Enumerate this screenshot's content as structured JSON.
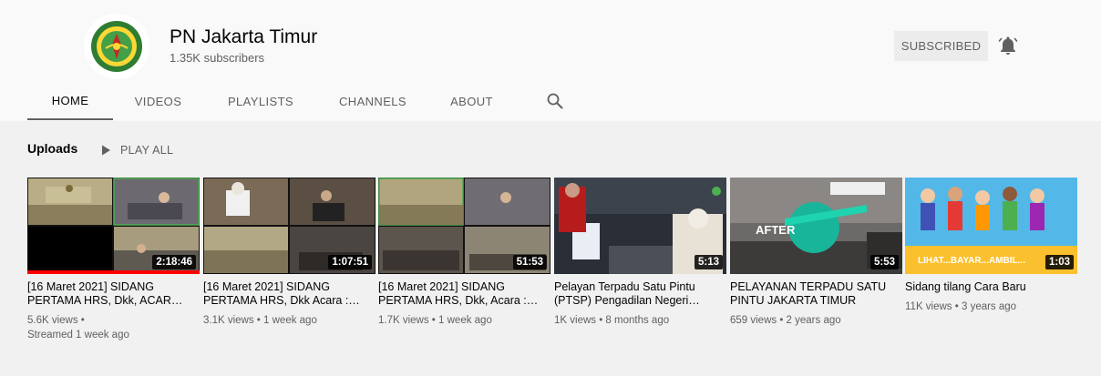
{
  "channel": {
    "name": "PN Jakarta Timur",
    "subscribers": "1.35K subscribers",
    "avatar_icon": "court-emblem-icon",
    "subscribe_label": "SUBSCRIBED",
    "bell_icon": "bell-icon"
  },
  "tabs": [
    {
      "label": "HOME",
      "active": true
    },
    {
      "label": "VIDEOS",
      "active": false
    },
    {
      "label": "PLAYLISTS",
      "active": false
    },
    {
      "label": "CHANNELS",
      "active": false
    },
    {
      "label": "ABOUT",
      "active": false
    }
  ],
  "search_icon": "search-icon",
  "uploads": {
    "title": "Uploads",
    "play_all_label": "PLAY ALL",
    "play_icon": "play-icon",
    "videos": [
      {
        "title": "[16 Maret 2021] SIDANG PERTAMA HRS, Dkk, ACAR…",
        "duration": "2:18:46",
        "meta1": "5.6K views •",
        "meta2": "Streamed 1 week ago",
        "watched_fraction": 1.0,
        "thumb_kind": "courtroom-green"
      },
      {
        "title": "[16 Maret 2021] SIDANG PERTAMA HRS, Dkk Acara :…",
        "duration": "1:07:51",
        "meta1": "3.1K views • 1 week ago",
        "meta2": "",
        "watched_fraction": 0,
        "thumb_kind": "courtroom-grid"
      },
      {
        "title": "[16 Maret 2021] SIDANG PERTAMA HRS, Dkk, Acara :…",
        "duration": "51:53",
        "meta1": "1.7K views • 1 week ago",
        "meta2": "",
        "watched_fraction": 0,
        "thumb_kind": "courtroom-green"
      },
      {
        "title": "Pelayan Terpadu Satu Pintu (PTSP) Pengadilan Negeri…",
        "duration": "5:13",
        "meta1": "1K views • 8 months ago",
        "meta2": "",
        "watched_fraction": 0,
        "thumb_kind": "service-desk"
      },
      {
        "title": "PELAYANAN TERPADU SATU PINTU JAKARTA TIMUR",
        "duration": "5:53",
        "meta1": "659 views • 2 years ago",
        "meta2": "",
        "watched_fraction": 0,
        "thumb_kind": "after-room",
        "thumb_text": "AFTER"
      },
      {
        "title": "Sidang tilang Cara Baru",
        "duration": "1:03",
        "meta1": "11K views • 3 years ago",
        "meta2": "",
        "watched_fraction": 0,
        "thumb_kind": "cartoon-people",
        "thumb_text": "LIHAT...BAYAR...AMBIL..."
      }
    ]
  },
  "colors": {
    "header_bg": "#f9f9f9",
    "page_bg": "#f1f1f1",
    "progress_red": "#ff0000",
    "secondary_text": "#606060"
  }
}
